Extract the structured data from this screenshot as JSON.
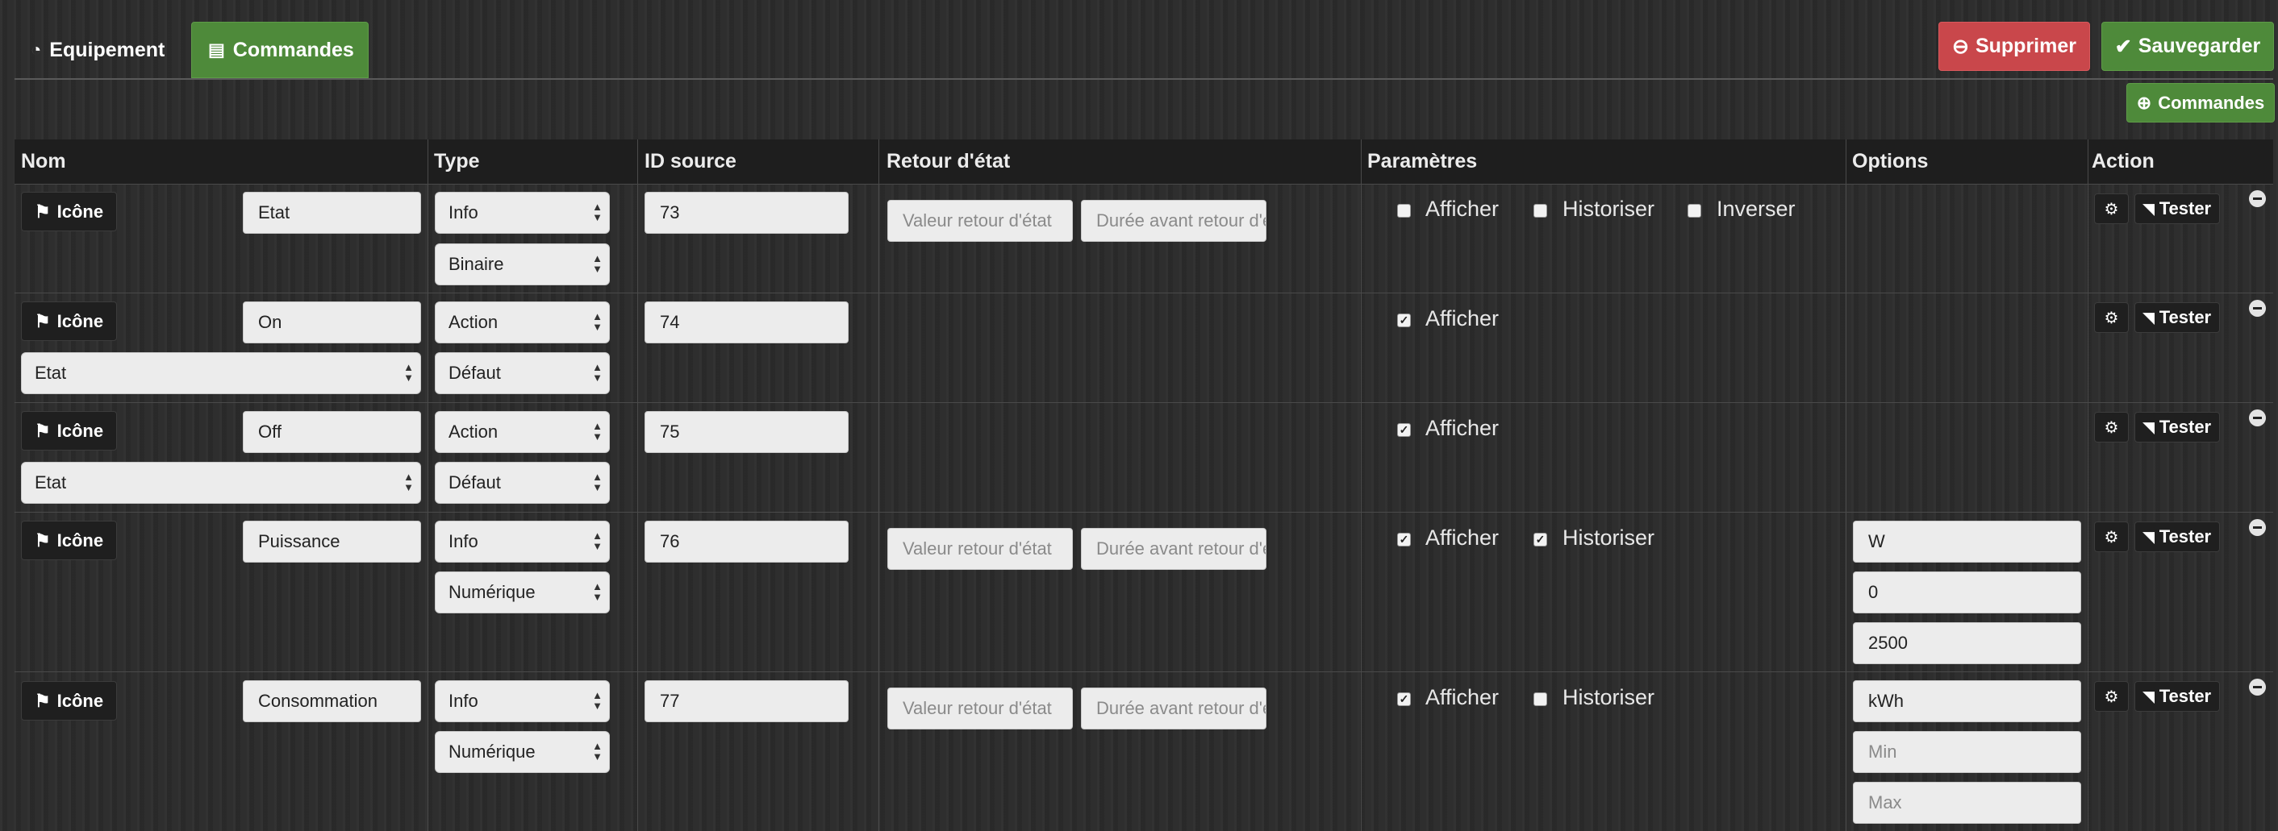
{
  "tabs": [
    {
      "label": "Equipement",
      "icon": "dashboard-icon"
    },
    {
      "label": "Commandes",
      "icon": "list-icon",
      "active": true
    }
  ],
  "toolbar": {
    "delete_label": "Supprimer",
    "save_label": "Sauvegarder",
    "add_commands_label": "Commandes"
  },
  "table": {
    "headers": [
      "Nom",
      "Type",
      "ID source",
      "Retour d'état",
      "Paramètres",
      "Options",
      "Action"
    ],
    "icon_button_label": "Icône",
    "tester_label": "Tester",
    "retour_placeholder": "Valeur retour d'état",
    "duree_placeholder": "Durée avant retour d'état",
    "rows": [
      {
        "name": "Etat",
        "type": "Info",
        "subtype": "Binaire",
        "id_source": "73",
        "params": [
          {
            "label": "Afficher",
            "checked": false
          },
          {
            "label": "Historiser",
            "checked": false
          },
          {
            "label": "Inverser",
            "checked": false
          }
        ]
      },
      {
        "name": "On",
        "type": "Action",
        "subtype": "Défaut",
        "id_source": "74",
        "linked": "Etat",
        "params": [
          {
            "label": "Afficher",
            "checked": true
          }
        ]
      },
      {
        "name": "Off",
        "type": "Action",
        "subtype": "Défaut",
        "id_source": "75",
        "linked": "Etat",
        "params": [
          {
            "label": "Afficher",
            "checked": true
          }
        ]
      },
      {
        "name": "Puissance",
        "type": "Info",
        "subtype": "Numérique",
        "id_source": "76",
        "params": [
          {
            "label": "Afficher",
            "checked": true
          },
          {
            "label": "Historiser",
            "checked": true
          }
        ],
        "options": {
          "unit": "W",
          "min": "0",
          "max": "2500"
        }
      },
      {
        "name": "Consommation",
        "type": "Info",
        "subtype": "Numérique",
        "id_source": "77",
        "params": [
          {
            "label": "Afficher",
            "checked": true
          },
          {
            "label": "Historiser",
            "checked": false
          }
        ],
        "options": {
          "unit": "kWh",
          "min_placeholder": "Min",
          "max_placeholder": "Max"
        }
      }
    ]
  },
  "colors": {
    "success": "#4e8a3a",
    "danger": "#c9474b",
    "background": "#2b2b2b"
  }
}
